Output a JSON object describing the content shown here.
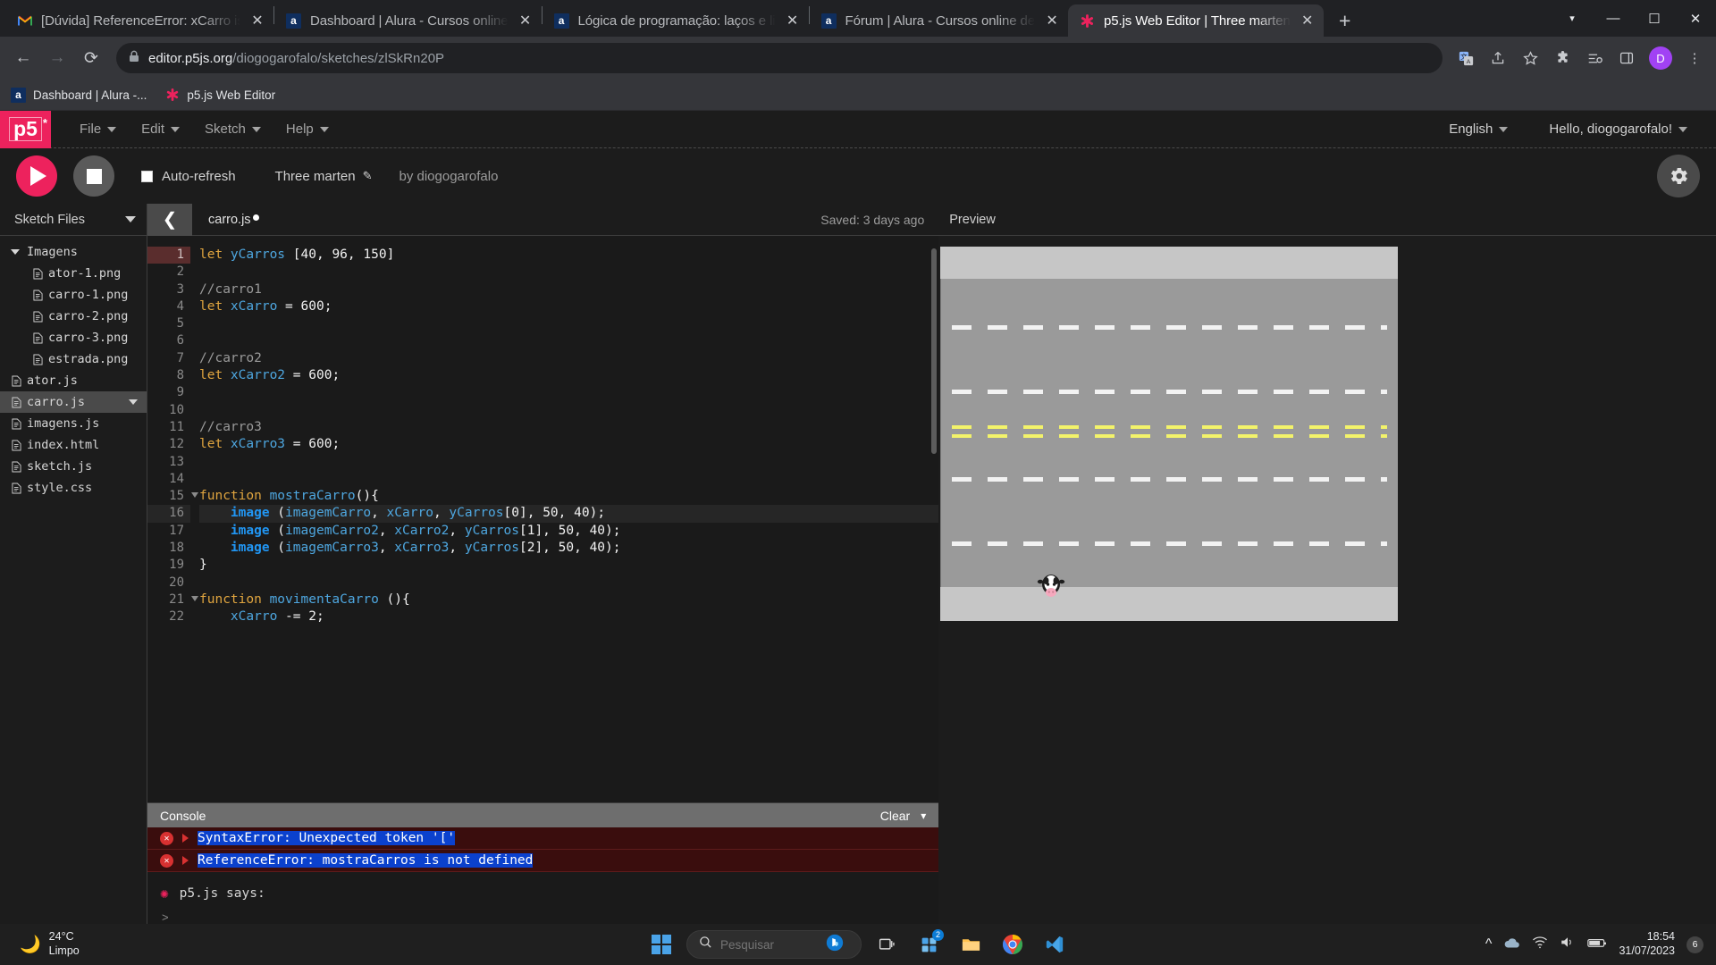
{
  "browser": {
    "tabs": [
      {
        "title": "[Dúvida] ReferenceError: xCarro is",
        "icon": "gmail-icon",
        "active": false
      },
      {
        "title": "Dashboard | Alura - Cursos online",
        "icon": "alura-icon",
        "active": false
      },
      {
        "title": "Lógica de programação: laços e li",
        "icon": "alura-icon",
        "active": false
      },
      {
        "title": "Fórum | Alura - Cursos online de",
        "icon": "alura-icon",
        "active": false
      },
      {
        "title": "p5.js Web Editor | Three marten",
        "icon": "p5-icon",
        "active": true
      }
    ],
    "new_tab_label": "+",
    "window_controls": {
      "minimize": "—",
      "maximize": "☐",
      "close": "✕",
      "tab_search": "▾"
    },
    "omnibox": {
      "url_domain": "editor.p5js.org",
      "url_path": "/diogogarofalo/sketches/zlSkRn20P",
      "lock_icon": "lock-icon",
      "back": "←",
      "forward": "→",
      "reload": "⟳"
    },
    "omni_actions": [
      "translate-icon",
      "share-icon",
      "bookmark-star-icon",
      "extensions-icon",
      "reading-list-icon",
      "side-panel-icon"
    ],
    "profile_initial": "D",
    "menu_icon": "⋮",
    "bookmarks": [
      {
        "label": "Dashboard | Alura -...",
        "icon": "alura-icon"
      },
      {
        "label": "p5.js Web Editor",
        "icon": "p5-asterisk-icon"
      }
    ]
  },
  "p5editor": {
    "logo": {
      "text": "p5",
      "sup": "*"
    },
    "menu": [
      "File",
      "Edit",
      "Sketch",
      "Help"
    ],
    "language": "English",
    "greeting": "Hello, diogogarofalo!",
    "toolbar": {
      "play_label": "play-button",
      "stop_label": "stop-button",
      "autorefresh_label": "Auto-refresh",
      "autorefresh_checked": false,
      "sketch_name": "Three marten",
      "byline": "by diogogarofalo",
      "settings_label": "settings"
    },
    "sidebar": {
      "header": "Sketch Files",
      "items": [
        {
          "label": "Imagens",
          "type": "folder",
          "depth": 0,
          "expanded": true,
          "selected": false
        },
        {
          "label": "ator-1.png",
          "type": "file",
          "depth": 1,
          "selected": false
        },
        {
          "label": "carro-1.png",
          "type": "file",
          "depth": 1,
          "selected": false
        },
        {
          "label": "carro-2.png",
          "type": "file",
          "depth": 1,
          "selected": false
        },
        {
          "label": "carro-3.png",
          "type": "file",
          "depth": 1,
          "selected": false
        },
        {
          "label": "estrada.png",
          "type": "file",
          "depth": 1,
          "selected": false
        },
        {
          "label": "ator.js",
          "type": "file",
          "depth": 0,
          "selected": false
        },
        {
          "label": "carro.js",
          "type": "file",
          "depth": 0,
          "selected": true
        },
        {
          "label": "imagens.js",
          "type": "file",
          "depth": 0,
          "selected": false
        },
        {
          "label": "index.html",
          "type": "file",
          "depth": 0,
          "selected": false
        },
        {
          "label": "sketch.js",
          "type": "file",
          "depth": 0,
          "selected": false
        },
        {
          "label": "style.css",
          "type": "file",
          "depth": 0,
          "selected": false
        }
      ]
    },
    "editor": {
      "collapse_icon": "chevron-left-icon",
      "open_file": "carro.js",
      "unsaved": true,
      "saved_status": "Saved: 3 days ago",
      "lines": [
        {
          "n": 1,
          "error": true,
          "current": false,
          "fold": false,
          "tokens": [
            {
              "t": "let ",
              "c": "kw"
            },
            {
              "t": "yCarros ",
              "c": "var"
            },
            {
              "t": "[",
              "c": "pun"
            },
            {
              "t": "40",
              "c": "num"
            },
            {
              "t": ", ",
              "c": "pun"
            },
            {
              "t": "96",
              "c": "num"
            },
            {
              "t": ", ",
              "c": "pun"
            },
            {
              "t": "150",
              "c": "num"
            },
            {
              "t": "]",
              "c": "pun"
            }
          ]
        },
        {
          "n": 2,
          "error": false,
          "current": false,
          "fold": false,
          "tokens": []
        },
        {
          "n": 3,
          "error": false,
          "current": false,
          "fold": false,
          "tokens": [
            {
              "t": "//carro1",
              "c": "cmt"
            }
          ]
        },
        {
          "n": 4,
          "error": false,
          "current": false,
          "fold": false,
          "tokens": [
            {
              "t": "let ",
              "c": "kw"
            },
            {
              "t": "xCarro",
              "c": "var"
            },
            {
              "t": " = ",
              "c": "pun"
            },
            {
              "t": "600",
              "c": "num"
            },
            {
              "t": ";",
              "c": "pun"
            }
          ]
        },
        {
          "n": 5,
          "error": false,
          "current": false,
          "fold": false,
          "tokens": []
        },
        {
          "n": 6,
          "error": false,
          "current": false,
          "fold": false,
          "tokens": []
        },
        {
          "n": 7,
          "error": false,
          "current": false,
          "fold": false,
          "tokens": [
            {
              "t": "//carro2",
              "c": "cmt"
            }
          ]
        },
        {
          "n": 8,
          "error": false,
          "current": false,
          "fold": false,
          "tokens": [
            {
              "t": "let ",
              "c": "kw"
            },
            {
              "t": "xCarro2",
              "c": "var"
            },
            {
              "t": " = ",
              "c": "pun"
            },
            {
              "t": "600",
              "c": "num"
            },
            {
              "t": ";",
              "c": "pun"
            }
          ]
        },
        {
          "n": 9,
          "error": false,
          "current": false,
          "fold": false,
          "tokens": []
        },
        {
          "n": 10,
          "error": false,
          "current": false,
          "fold": false,
          "tokens": []
        },
        {
          "n": 11,
          "error": false,
          "current": false,
          "fold": false,
          "tokens": [
            {
              "t": "//carro3",
              "c": "cmt"
            }
          ]
        },
        {
          "n": 12,
          "error": false,
          "current": false,
          "fold": false,
          "tokens": [
            {
              "t": "let ",
              "c": "kw"
            },
            {
              "t": "xCarro3",
              "c": "var"
            },
            {
              "t": " = ",
              "c": "pun"
            },
            {
              "t": "600",
              "c": "num"
            },
            {
              "t": ";",
              "c": "pun"
            }
          ]
        },
        {
          "n": 13,
          "error": false,
          "current": false,
          "fold": false,
          "tokens": []
        },
        {
          "n": 14,
          "error": false,
          "current": false,
          "fold": false,
          "tokens": []
        },
        {
          "n": 15,
          "error": false,
          "current": false,
          "fold": true,
          "tokens": [
            {
              "t": "function ",
              "c": "kw"
            },
            {
              "t": "mostraCarro",
              "c": "var"
            },
            {
              "t": "(){",
              "c": "pun"
            }
          ]
        },
        {
          "n": 16,
          "error": false,
          "current": true,
          "fold": false,
          "tokens": [
            {
              "t": "    ",
              "c": "pun"
            },
            {
              "t": "image",
              "c": "bfn"
            },
            {
              "t": " (",
              "c": "pun"
            },
            {
              "t": "imagemCarro",
              "c": "var"
            },
            {
              "t": ", ",
              "c": "pun"
            },
            {
              "t": "xCarro",
              "c": "var"
            },
            {
              "t": ", ",
              "c": "pun"
            },
            {
              "t": "yCarros",
              "c": "var"
            },
            {
              "t": "[",
              "c": "pun"
            },
            {
              "t": "0",
              "c": "num"
            },
            {
              "t": "], ",
              "c": "pun"
            },
            {
              "t": "50",
              "c": "num"
            },
            {
              "t": ", ",
              "c": "pun"
            },
            {
              "t": "40",
              "c": "num"
            },
            {
              "t": ");",
              "c": "pun"
            }
          ]
        },
        {
          "n": 17,
          "error": false,
          "current": false,
          "fold": false,
          "tokens": [
            {
              "t": "    ",
              "c": "pun"
            },
            {
              "t": "image",
              "c": "bfn"
            },
            {
              "t": " (",
              "c": "pun"
            },
            {
              "t": "imagemCarro2",
              "c": "var"
            },
            {
              "t": ", ",
              "c": "pun"
            },
            {
              "t": "xCarro2",
              "c": "var"
            },
            {
              "t": ", ",
              "c": "pun"
            },
            {
              "t": "yCarros",
              "c": "var"
            },
            {
              "t": "[",
              "c": "pun"
            },
            {
              "t": "1",
              "c": "num"
            },
            {
              "t": "], ",
              "c": "pun"
            },
            {
              "t": "50",
              "c": "num"
            },
            {
              "t": ", ",
              "c": "pun"
            },
            {
              "t": "40",
              "c": "num"
            },
            {
              "t": ");",
              "c": "pun"
            }
          ]
        },
        {
          "n": 18,
          "error": false,
          "current": false,
          "fold": false,
          "tokens": [
            {
              "t": "    ",
              "c": "pun"
            },
            {
              "t": "image",
              "c": "bfn"
            },
            {
              "t": " (",
              "c": "pun"
            },
            {
              "t": "imagemCarro3",
              "c": "var"
            },
            {
              "t": ", ",
              "c": "pun"
            },
            {
              "t": "xCarro3",
              "c": "var"
            },
            {
              "t": ", ",
              "c": "pun"
            },
            {
              "t": "yCarros",
              "c": "var"
            },
            {
              "t": "[",
              "c": "pun"
            },
            {
              "t": "2",
              "c": "num"
            },
            {
              "t": "], ",
              "c": "pun"
            },
            {
              "t": "50",
              "c": "num"
            },
            {
              "t": ", ",
              "c": "pun"
            },
            {
              "t": "40",
              "c": "num"
            },
            {
              "t": ");",
              "c": "pun"
            }
          ]
        },
        {
          "n": 19,
          "error": false,
          "current": false,
          "fold": false,
          "tokens": [
            {
              "t": "}",
              "c": "pun"
            }
          ]
        },
        {
          "n": 20,
          "error": false,
          "current": false,
          "fold": false,
          "tokens": []
        },
        {
          "n": 21,
          "error": false,
          "current": false,
          "fold": true,
          "tokens": [
            {
              "t": "function ",
              "c": "kw"
            },
            {
              "t": "movimentaCarro",
              "c": "var"
            },
            {
              "t": " (){",
              "c": "pun"
            }
          ]
        },
        {
          "n": 22,
          "error": false,
          "current": false,
          "fold": false,
          "tokens": [
            {
              "t": "    ",
              "c": "pun"
            },
            {
              "t": "xCarro",
              "c": "var"
            },
            {
              "t": " -= ",
              "c": "pun"
            },
            {
              "t": "2",
              "c": "num"
            },
            {
              "t": ";",
              "c": "pun"
            }
          ]
        }
      ]
    },
    "console": {
      "title": "Console",
      "clear_label": "Clear",
      "collapse_icon": "chevron-down-icon",
      "messages": [
        {
          "type": "error",
          "text": "SyntaxError: Unexpected token '['"
        },
        {
          "type": "error",
          "text": "ReferenceError: mostraCarros is not defined"
        }
      ],
      "p5_says": "p5.js says:",
      "prompt": ">"
    },
    "preview": {
      "title": "Preview",
      "sketch": {
        "sky_color": "#c6c6c6",
        "road_color": "#9a9a9a",
        "lane_marker_color": "#f2f2f2",
        "center_line_color": "#f3f36a",
        "lanes": 5,
        "actor": "cow-sprite"
      }
    },
    "colors": {
      "accent": "#ed225d",
      "editor_bg": "#1a1a1a",
      "chrome_bg": "#202124"
    }
  },
  "taskbar": {
    "weather": {
      "temp": "24°C",
      "condition": "Limpo",
      "icon": "moon-icon"
    },
    "start_label": "start-button",
    "search_placeholder": "Pesquisar",
    "apps": [
      {
        "name": "task-view-icon",
        "badge": null
      },
      {
        "name": "widgets-icon",
        "badge": "2"
      },
      {
        "name": "file-explorer-icon",
        "badge": null
      },
      {
        "name": "chrome-icon",
        "badge": null
      },
      {
        "name": "vscode-icon",
        "badge": null
      }
    ],
    "tray": [
      "show-hidden-icon",
      "onedrive-icon",
      "wifi-icon",
      "volume-icon",
      "battery-icon"
    ],
    "clock": {
      "time": "18:54",
      "date": "31/07/2023"
    },
    "notification_count": "6"
  }
}
